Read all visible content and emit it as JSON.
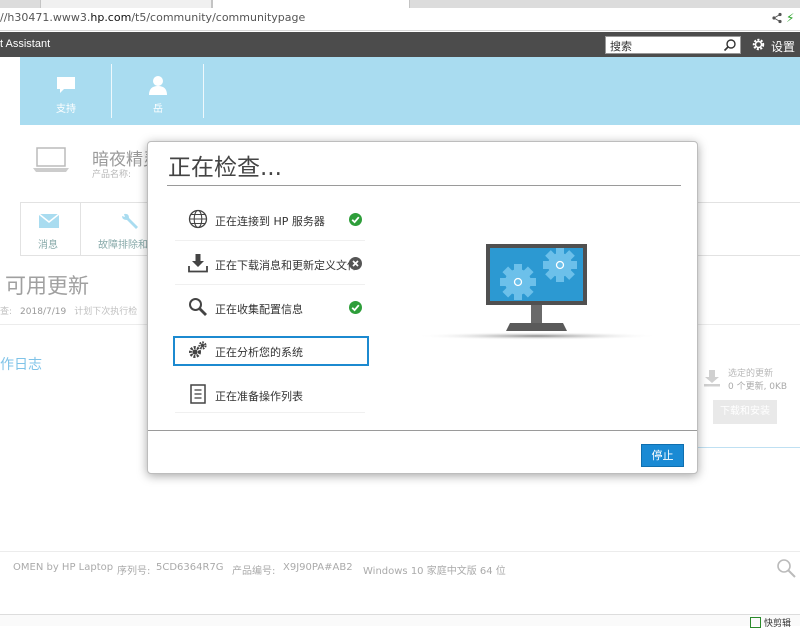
{
  "browser": {
    "url_prefix": "//h30471.www3.",
    "url_domain": "hp.com",
    "url_path": "/t5/community/communitypage"
  },
  "app": {
    "title": "t Assistant",
    "search_placeholder": "搜索",
    "settings_label": "设置"
  },
  "nav": {
    "items": [
      {
        "label": "支持",
        "icon": "chat-bubble-icon"
      },
      {
        "label": "岳",
        "icon": "user-icon"
      }
    ]
  },
  "device": {
    "name": "暗夜精灵",
    "product_name_label": "产品名称:"
  },
  "subnav": {
    "items": [
      {
        "label": "消息",
        "icon": "mail-icon"
      },
      {
        "label": "故障排除和",
        "icon": "wrench-icon"
      }
    ]
  },
  "updates": {
    "title": "可用更新",
    "last_check_label": "查:",
    "last_check_date": "2018/7/19",
    "plan_label": "计划下次执行检",
    "log_link": "作日志",
    "selected_label": "选定的更新",
    "selected_count": "0 个更新, 0KB",
    "download_button": "下载和安装"
  },
  "footer": {
    "model": "OMEN by HP Laptop",
    "serial_label": "序列号:",
    "serial": "5CD6364R7G",
    "product_label": "产品编号:",
    "product_no": "X9J90PA#AB2",
    "os": "Windows 10 家庭中文版 64 位"
  },
  "status_bar": {
    "clip_label": "快剪辑"
  },
  "dialog": {
    "title": "正在检查...",
    "steps": [
      {
        "label": "正在连接到 HP 服务器",
        "icon": "globe-icon",
        "status": "success"
      },
      {
        "label": "正在下载消息和更新定义文件",
        "icon": "download-icon",
        "status": "error"
      },
      {
        "label": "正在收集配置信息",
        "icon": "magnifier-icon",
        "status": "success"
      },
      {
        "label": "正在分析您的系统",
        "icon": "gears-icon",
        "status": "active"
      },
      {
        "label": "正在准备操作列表",
        "icon": "document-list-icon",
        "status": "pending"
      }
    ],
    "stop_button": "停止",
    "colors": {
      "accent": "#1a8ad4",
      "success": "#2e9e3a",
      "error": "#555555",
      "monitor_screen": "#2c99d2"
    }
  }
}
